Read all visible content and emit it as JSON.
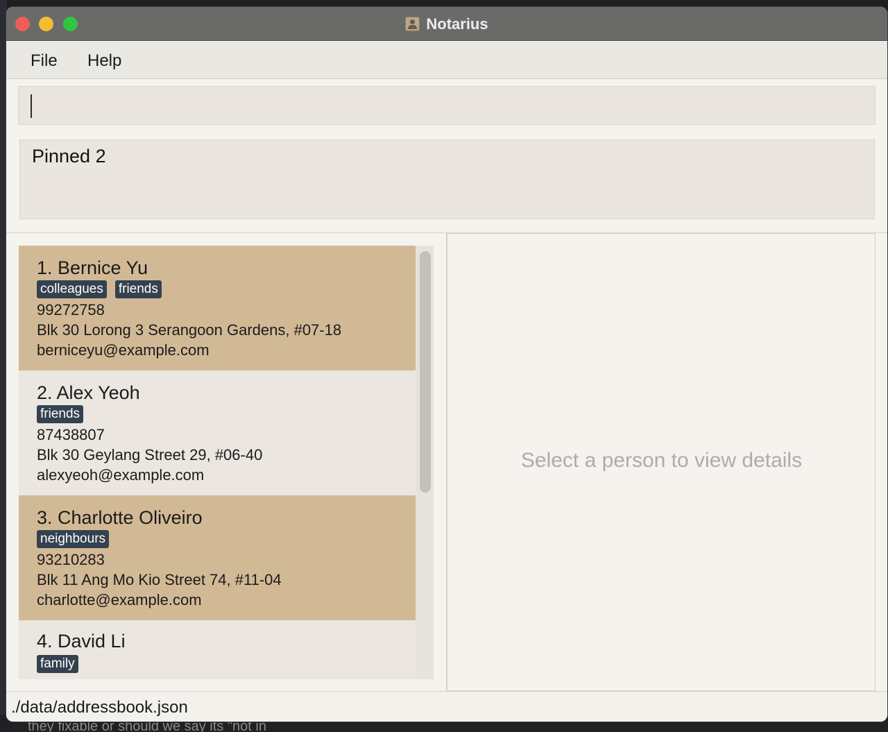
{
  "window": {
    "title": "Notarius"
  },
  "menu": {
    "file": "File",
    "help": "Help"
  },
  "command": {
    "value": ""
  },
  "pinned": {
    "label": "Pinned 2"
  },
  "persons": [
    {
      "name": "1. Bernice Yu",
      "tags": [
        "colleagues",
        "friends"
      ],
      "phone": "99272758",
      "address": "Blk 30 Lorong 3 Serangoon Gardens, #07-18",
      "email": "berniceyu@example.com"
    },
    {
      "name": "2. Alex Yeoh",
      "tags": [
        "friends"
      ],
      "phone": "87438807",
      "address": "Blk 30 Geylang Street 29, #06-40",
      "email": "alexyeoh@example.com"
    },
    {
      "name": "3. Charlotte Oliveiro",
      "tags": [
        "neighbours"
      ],
      "phone": "93210283",
      "address": "Blk 11 Ang Mo Kio Street 74, #11-04",
      "email": "charlotte@example.com"
    },
    {
      "name": "4. David Li",
      "tags": [
        "family"
      ],
      "phone": "",
      "address": "",
      "email": ""
    }
  ],
  "detail": {
    "placeholder": "Select a person to view details"
  },
  "status": {
    "path": "./data/addressbook.json"
  },
  "background": {
    "partial_text": "they fixable or should we say its \"not in"
  },
  "colors": {
    "highlight_card": "#d2b996",
    "plain_card": "#ebe6e0",
    "tag": "#34414f"
  }
}
